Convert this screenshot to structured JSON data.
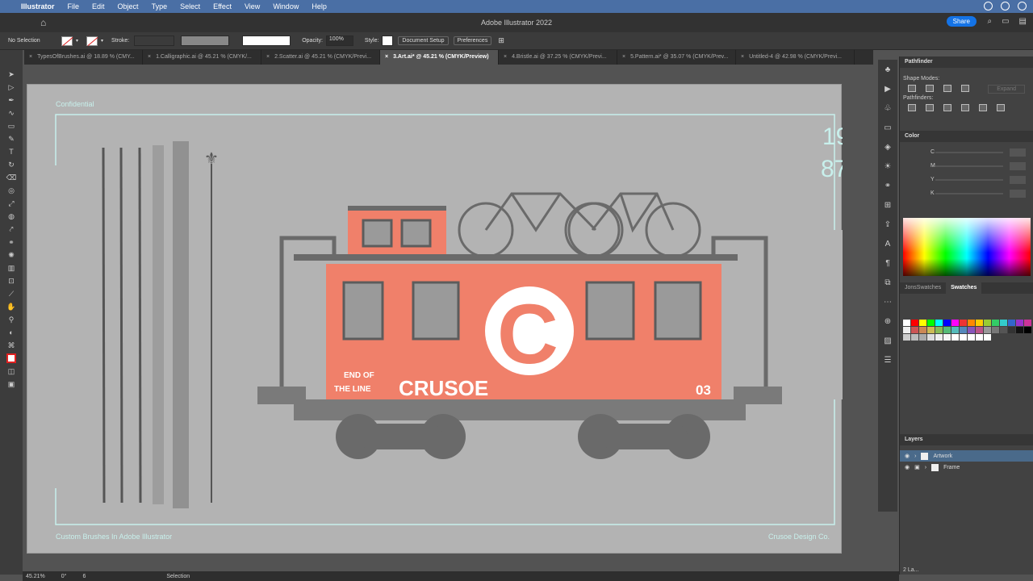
{
  "menubar": {
    "app_name": "Illustrator",
    "items": [
      "File",
      "Edit",
      "Object",
      "Type",
      "Select",
      "Effect",
      "View",
      "Window",
      "Help"
    ]
  },
  "titlebar": {
    "title": "Adobe Illustrator 2022",
    "share_label": "Share"
  },
  "control_bar": {
    "selection": "No Selection",
    "stroke_label": "Stroke:",
    "opacity_label": "Opacity:",
    "opacity_value": "100%",
    "style_label": "Style:",
    "document_setup": "Document Setup",
    "preferences": "Preferences"
  },
  "tabs": [
    "TypesOfBrushes.ai @ 18.89 % (CMY...",
    "1.Calligraphic.ai @ 45.21 % (CMYK/...",
    "2.Scatter.ai @ 45.21 % (CMYK/Previ...",
    "3.Art.ai* @ 45.21 % (CMYK/Preview)",
    "4.Bristle.ai @ 37.25 % (CMYK/Previ...",
    "5.Pattern.ai* @ 35.07 % (CMYK/Prev...",
    "Untitled-4 @ 42.98 % (CMYK/Previ..."
  ],
  "active_tab_index": 3,
  "artboard": {
    "confidential": "Confidential",
    "year_top": "19",
    "year_bottom": "87",
    "footer_left": "Custom Brushes In Adobe Illustrator",
    "footer_right": "Crusoe Design Co.",
    "car_number": "03",
    "graffiti_line1": "END OF",
    "graffiti_line2": "THE LINE",
    "graffiti_big": "CRUSOE"
  },
  "panels": {
    "pathfinder": {
      "title": "Pathfinder",
      "shape_modes": "Shape Modes:",
      "pathfinders": "Pathfinders:",
      "expand": "Expand"
    },
    "color": {
      "title": "Color",
      "channels": [
        "C",
        "M",
        "Y",
        "K"
      ]
    },
    "swatches": {
      "tab1": "JonsSwatches",
      "tab2": "Swatches"
    },
    "layers": {
      "title": "Layers",
      "items": [
        "Artwork",
        "Frame"
      ],
      "footer": "2 La..."
    }
  },
  "status": {
    "zoom": "45.21%",
    "rotation": "0°",
    "artboard": "6",
    "tool": "Selection"
  },
  "colors": {
    "accent_orange": "#f0806a",
    "frame_cyan": "#c8f0ec",
    "ink_gray": "#5c5c5c"
  }
}
